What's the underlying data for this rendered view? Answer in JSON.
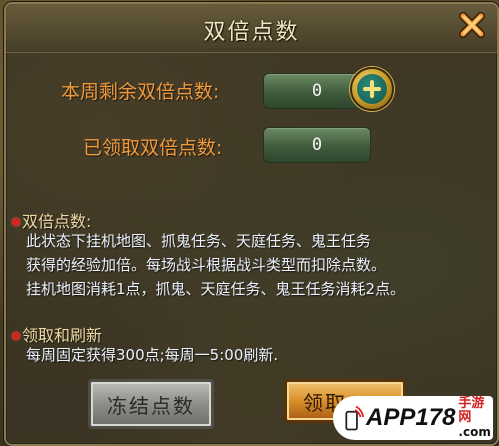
{
  "dialog": {
    "title": "双倍点数",
    "remaining_label": "本周剩余双倍点数:",
    "remaining_value": "0",
    "claimed_label": "已领取双倍点数:",
    "claimed_value": "0"
  },
  "sections": [
    {
      "heading": "双倍点数:",
      "lines": [
        "此状态下挂机地图、抓鬼任务、天庭任务、鬼王任务",
        "获得的经验加倍。每场战斗根据战斗类型而扣除点数。",
        "挂机地图消耗1点，抓鬼、天庭任务、鬼王任务消耗2点。"
      ]
    },
    {
      "heading": "领取和刷新",
      "lines": [
        "每周固定获得300点;每周一5:00刷新."
      ]
    }
  ],
  "buttons": {
    "freeze_label": "冻结点数",
    "claim_label": "领取"
  },
  "watermark": {
    "brand": "APP178",
    "sub": "手游网",
    "url": ".com"
  },
  "colors": {
    "label_orange": "#ef9a3f",
    "body_text": "#eaf1ff",
    "bullet_red": "#d8231b",
    "title": "#f2e6c4"
  },
  "icons": {
    "close": "close-x-icon",
    "plus": "plus-icon",
    "bullet": "red-dot-icon"
  }
}
